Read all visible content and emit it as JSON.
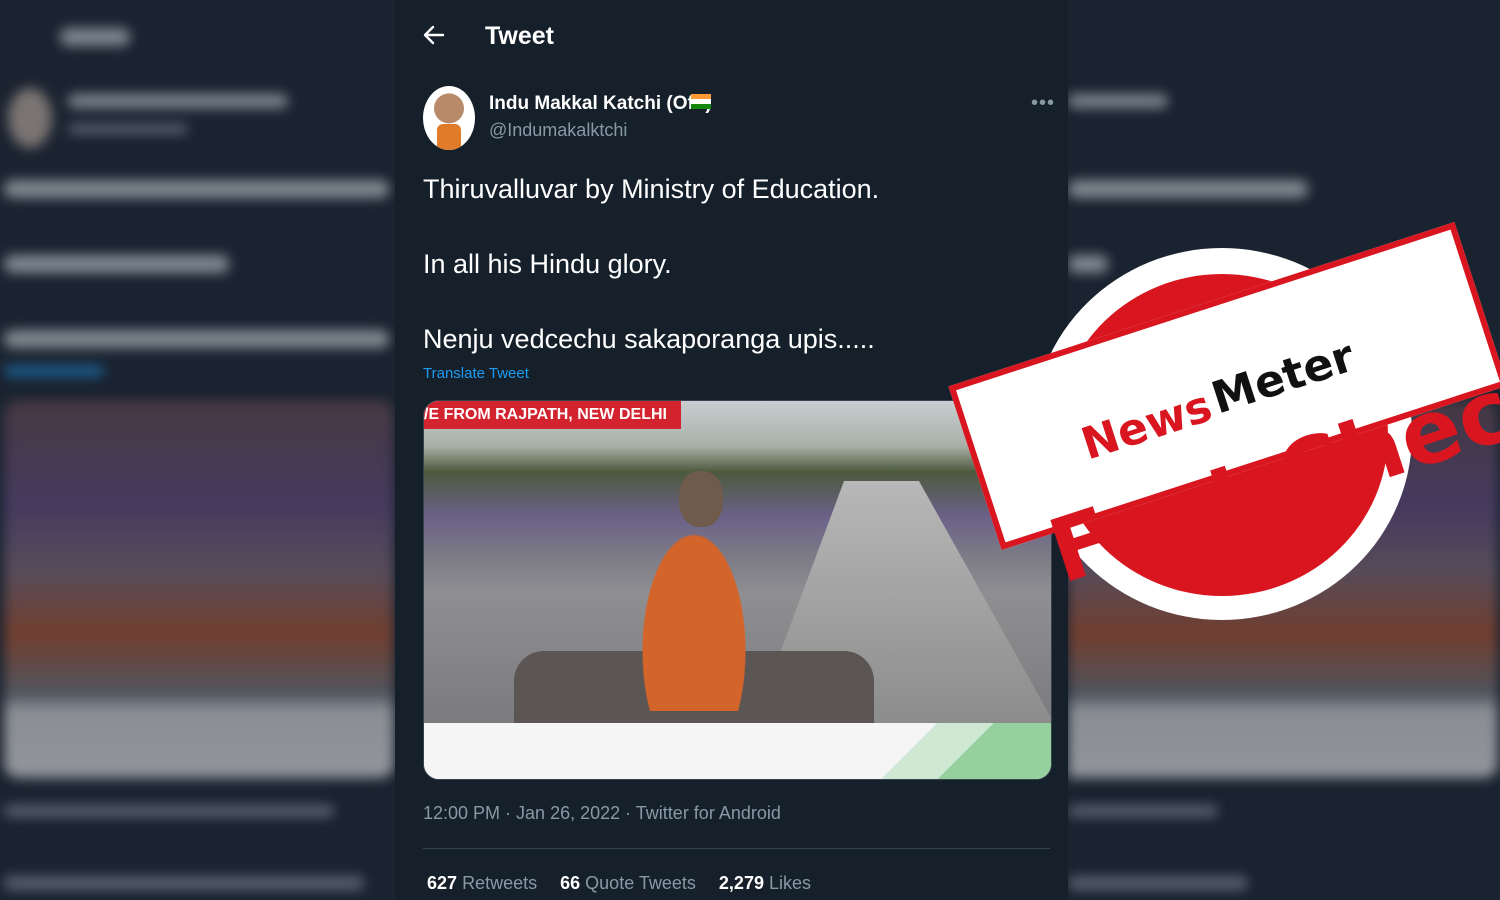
{
  "header": {
    "title": "Tweet"
  },
  "tweet": {
    "author_name": "Indu Makkal Katchi (Offl)",
    "author_handle": "@Indumakalktchi",
    "lines": [
      "Thiruvalluvar by Ministry of Education.",
      "In all his Hindu glory.",
      "Nenju vedcechu sakaporanga upis....."
    ],
    "translate_label": "Translate Tweet",
    "media": {
      "banner_text": "/E FROM RAJPATH, NEW DELHI"
    },
    "meta": "12:00 PM · Jan 26, 2022 · Twitter for Android",
    "stats": [
      {
        "value": "627",
        "label": "Retweets"
      },
      {
        "value": "66",
        "label": "Quote Tweets"
      },
      {
        "value": "2,279",
        "label": "Likes"
      }
    ]
  },
  "stamp": {
    "brand_part1": "News",
    "brand_part2": "Meter",
    "label": "Fact Check"
  },
  "colors": {
    "background": "#15202b",
    "link": "#1d9bf0",
    "stamp_red": "#d9161f"
  }
}
